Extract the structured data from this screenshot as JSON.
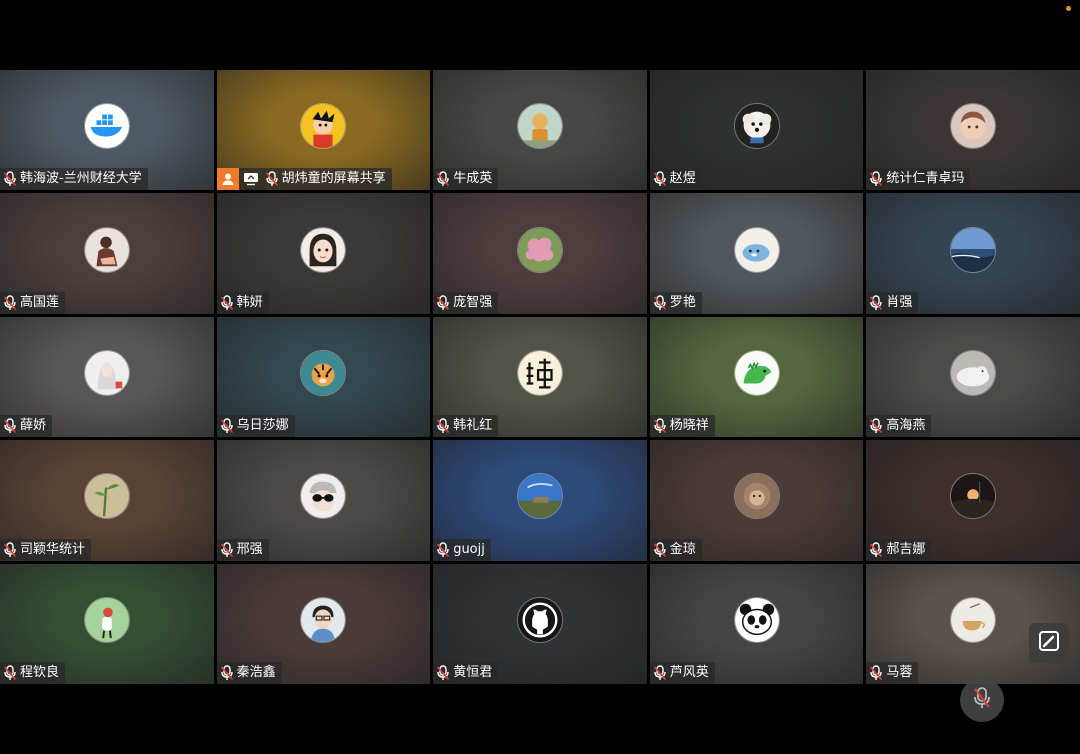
{
  "participants": [
    {
      "name": "韩海波-兰州财经大学",
      "bg": "#4e5a63",
      "avatar": "docker-icon"
    },
    {
      "name": "胡炜童的屏幕共享",
      "bg": "#8a6a21",
      "avatar": "cartoon-boy-avatar",
      "sharing": true
    },
    {
      "name": "牛成英",
      "bg": "#474845",
      "avatar": "figure-avatar"
    },
    {
      "name": "赵煜",
      "bg": "#2f3030",
      "avatar": "dog-avatar"
    },
    {
      "name": "统计仁青卓玛",
      "bg": "#3b3634",
      "avatar": "baby-avatar"
    },
    {
      "name": "高国莲",
      "bg": "#4b3f3c",
      "avatar": "woman-photo-avatar"
    },
    {
      "name": "韩妍",
      "bg": "#3c3838",
      "avatar": "cartoon-girl-avatar"
    },
    {
      "name": "庞智强",
      "bg": "#4d3d3d",
      "avatar": "flower-avatar"
    },
    {
      "name": "罗艳",
      "bg": "#51575c",
      "avatar": "cartoon-seal-avatar"
    },
    {
      "name": "肖强",
      "bg": "#354452",
      "avatar": "seascape-avatar"
    },
    {
      "name": "薛娇",
      "bg": "#5a5658",
      "avatar": "white-portrait-avatar"
    },
    {
      "name": "乌日莎娜",
      "bg": "#33474e",
      "avatar": "tiger-avatar"
    },
    {
      "name": "韩礼红",
      "bg": "#525448",
      "avatar": "han-seal-avatar"
    },
    {
      "name": "杨晓祥",
      "bg": "#55673e",
      "avatar": "dinosaur-avatar"
    },
    {
      "name": "高海燕",
      "bg": "#4b4b4a",
      "avatar": "cat-avatar"
    },
    {
      "name": "司颖华统计",
      "bg": "#5a4335",
      "avatar": "plant-avatar"
    },
    {
      "name": "邢强",
      "bg": "#4b4a48",
      "avatar": "sunglasses-avatar"
    },
    {
      "name": "guojj",
      "bg": "#2d4a7a",
      "avatar": "landscape-avatar"
    },
    {
      "name": "金琼",
      "bg": "#4b3b36",
      "avatar": "lion-avatar"
    },
    {
      "name": "郝吉娜",
      "bg": "#3d302d",
      "avatar": "sunset-avatar"
    },
    {
      "name": "程钦良",
      "bg": "#344f34",
      "avatar": "cartoon-character-avatar"
    },
    {
      "name": "秦浩鑫",
      "bg": "#4a3b39",
      "avatar": "cartoon-man-avatar"
    },
    {
      "name": "黄恒君",
      "bg": "#303234",
      "avatar": "github-icon"
    },
    {
      "name": "芦风英",
      "bg": "#454545",
      "avatar": "panda-avatar"
    },
    {
      "name": "马蓉",
      "bg": "#5a524c",
      "avatar": "teacup-avatar"
    }
  ],
  "icons": {
    "muted": "mic-muted-icon",
    "share_person": "person-icon",
    "share_screen": "screen-share-icon",
    "edit": "edit-icon",
    "mute_button": "mic-muted-icon"
  },
  "colors": {
    "background": "#000000",
    "share_badge": "#ef7c2b",
    "status_dot": "#e8902a",
    "mute_slash": "#e0413a"
  }
}
